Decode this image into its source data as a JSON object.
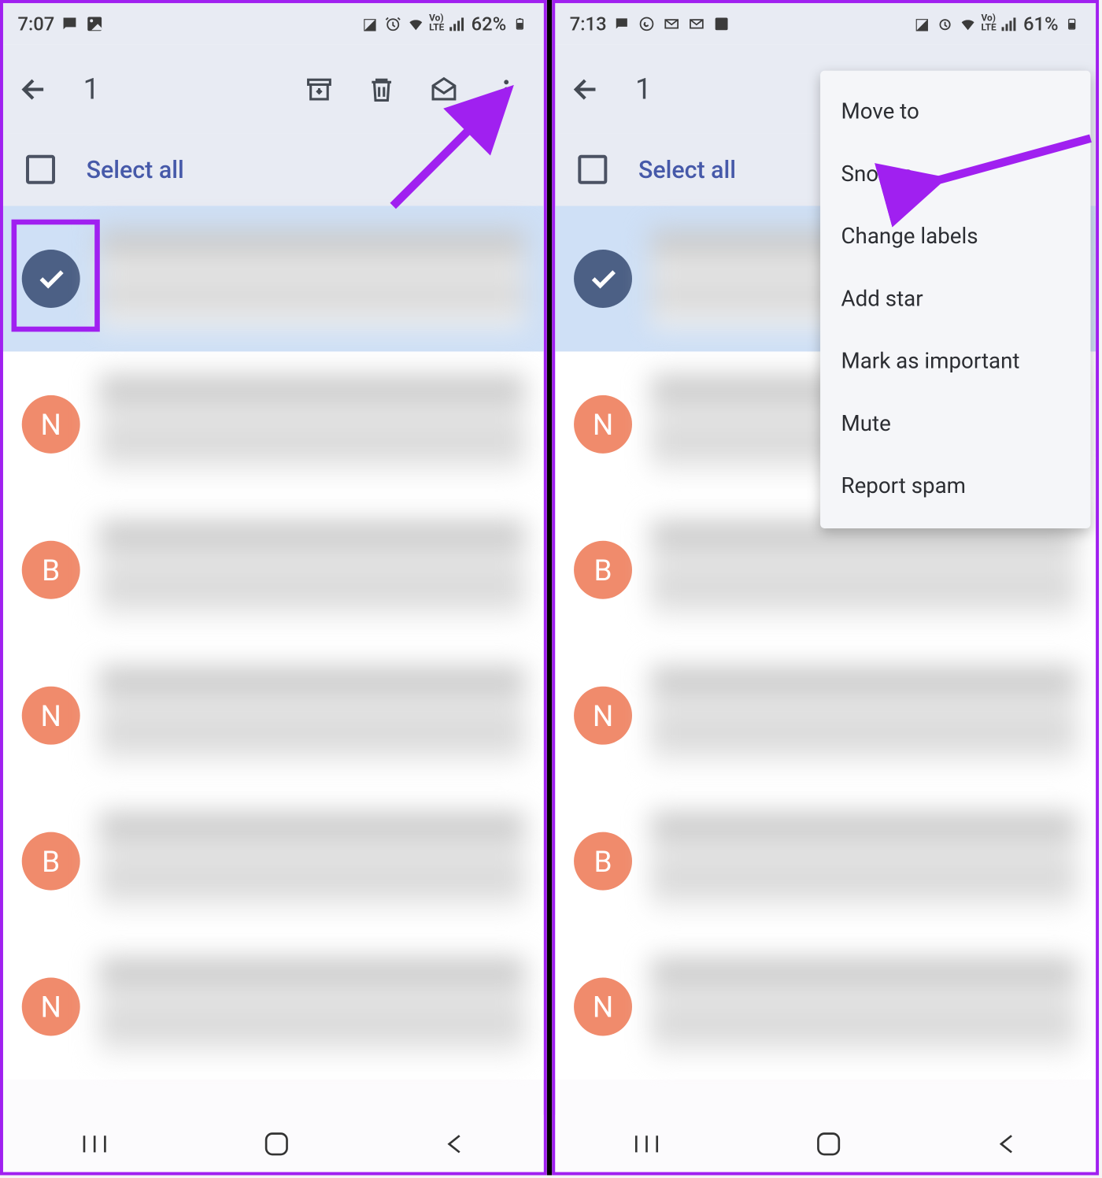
{
  "left": {
    "status": {
      "time": "7:07",
      "battery": "62%"
    },
    "toolbar": {
      "count": "1"
    },
    "select_all": "Select all",
    "rows": [
      {
        "selected": true,
        "letter": "",
        "check": true
      },
      {
        "selected": false,
        "letter": "N"
      },
      {
        "selected": false,
        "letter": "B"
      },
      {
        "selected": false,
        "letter": "N"
      },
      {
        "selected": false,
        "letter": "B"
      },
      {
        "selected": false,
        "letter": "N"
      }
    ]
  },
  "right": {
    "status": {
      "time": "7:13",
      "battery": "61%"
    },
    "toolbar": {
      "count": "1"
    },
    "select_all": "Select all",
    "menu": {
      "move_to": "Move to",
      "snooze": "Snooze",
      "change_labels": "Change labels",
      "add_star": "Add star",
      "mark_important": "Mark as important",
      "mute": "Mute",
      "report_spam": "Report spam"
    },
    "rows": [
      {
        "selected": true,
        "letter": "",
        "check": true
      },
      {
        "selected": false,
        "letter": "N"
      },
      {
        "selected": false,
        "letter": "B"
      },
      {
        "selected": false,
        "letter": "N"
      },
      {
        "selected": false,
        "letter": "B"
      },
      {
        "selected": false,
        "letter": "N"
      }
    ]
  },
  "colors": {
    "accent": "#a020f0",
    "avatar_orange": "#f08b6c",
    "avatar_check": "#4c6085"
  }
}
